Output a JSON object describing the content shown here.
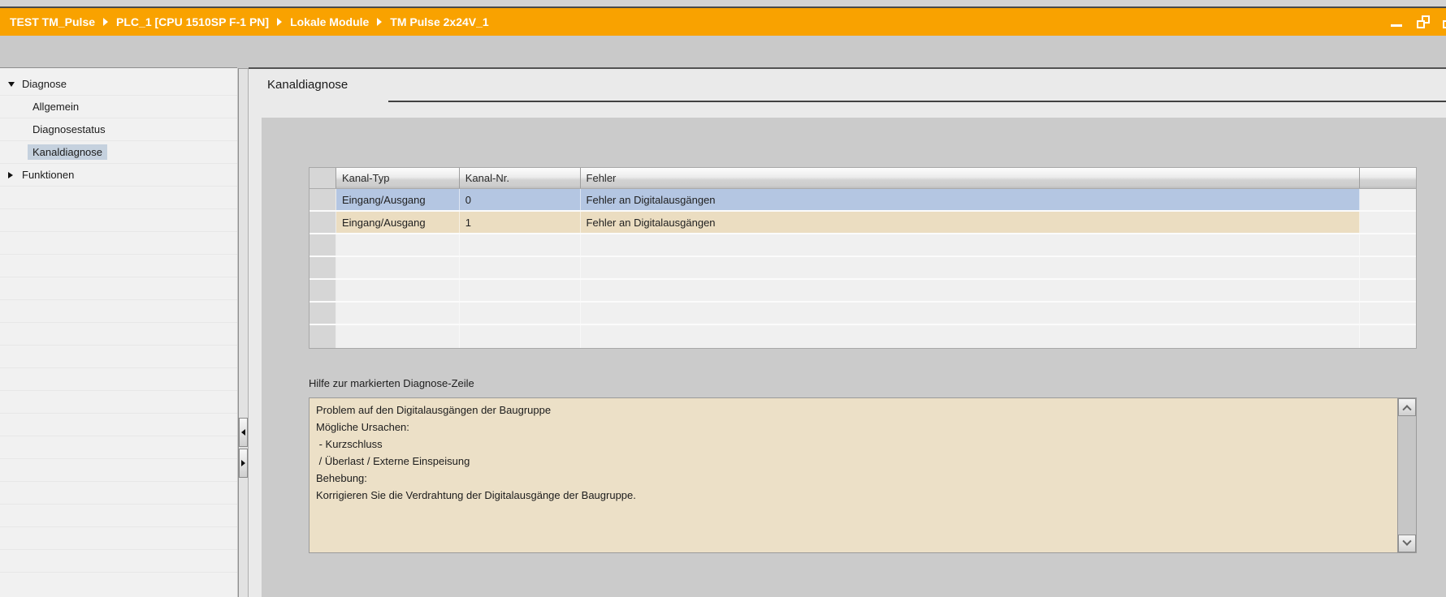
{
  "window": {
    "breadcrumb": [
      "TEST TM_Pulse",
      "PLC_1 [CPU 1510SP F-1 PN]",
      "Lokale Module",
      "TM Pulse 2x24V_1"
    ]
  },
  "sidebar": {
    "items": [
      {
        "label": "Diagnose",
        "level": 0,
        "state": "expanded"
      },
      {
        "label": "Allgemein",
        "level": 1,
        "state": "normal"
      },
      {
        "label": "Diagnosestatus",
        "level": 1,
        "state": "normal"
      },
      {
        "label": "Kanaldiagnose",
        "level": 1,
        "state": "selected"
      },
      {
        "label": "Funktionen",
        "level": 0,
        "state": "collapsed"
      }
    ]
  },
  "main": {
    "title": "Kanaldiagnose",
    "table": {
      "columns": [
        "Kanal-Typ",
        "Kanal-Nr.",
        "Fehler"
      ],
      "rows": [
        {
          "kanal_typ": "Eingang/Ausgang",
          "kanal_nr": "0",
          "fehler": "Fehler an Digitalausgängen",
          "highlight": "selected-blue"
        },
        {
          "kanal_typ": "Eingang/Ausgang",
          "kanal_nr": "1",
          "fehler": "Fehler an Digitalausgängen",
          "highlight": "warning-beige"
        }
      ],
      "empty_row_count": 5
    },
    "help": {
      "label": "Hilfe zur markierten Diagnose-Zeile",
      "lines": [
        "Problem auf den Digitalausgängen der Baugruppe",
        "Mögliche Ursachen:",
        " - Kurzschluss",
        " / Überlast / Externe Einspeisung",
        "Behebung:",
        "Korrigieren Sie die Verdrahtung der Digitalausgänge der Baugruppe."
      ]
    }
  },
  "colors": {
    "titlebar_orange": "#f9a200",
    "row_selected_blue": "#b4c6e2",
    "row_warning_beige": "#ebddc1",
    "help_box_beige": "#ece0c7",
    "panel_gray": "#cbcbcb",
    "sidebar_selected": "#c5d1de"
  }
}
